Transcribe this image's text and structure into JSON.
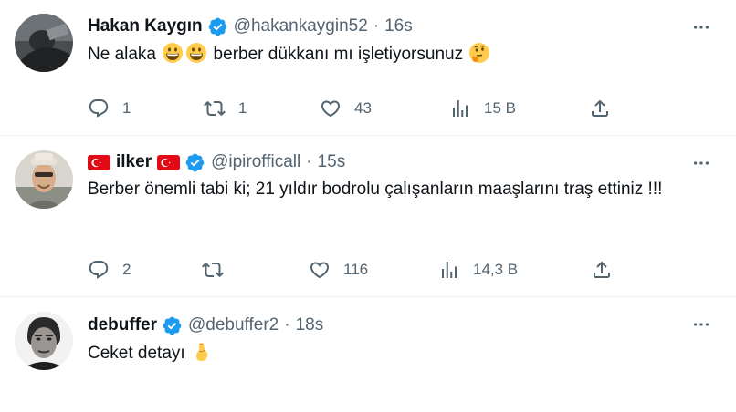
{
  "tweets": [
    {
      "name": "Hakan Kaygın",
      "handle": "@hakankaygin52",
      "separator": "·",
      "time": "16s",
      "text_before": "Ne alaka ",
      "text_after": " berber dükkanı mı işletiyorsunuz ",
      "emojis": [
        "grinning-face-emoji",
        "grinning-face-emoji",
        "thinking-face-emoji"
      ],
      "replies": "1",
      "reposts": "1",
      "likes": "43",
      "views": "15 B"
    },
    {
      "name": "ilker",
      "handle": "@ipirofficall",
      "separator": "·",
      "time": "15s",
      "text": "Berber önemli tabi ki;  21 yıldır bodrolu çalışanların maaşlarını traş ettiniz !!!",
      "replies": "2",
      "reposts": "",
      "likes": "116",
      "views": "14,3 B"
    },
    {
      "name": "debuffer",
      "handle": "@debuffer2",
      "separator": "·",
      "time": "18s",
      "text": "Ceket detayı ",
      "emojis": [
        "pinched-fingers-emoji"
      ]
    }
  ],
  "icons": [
    "verified-badge-icon",
    "more-icon",
    "reply-icon",
    "repost-icon",
    "like-icon",
    "views-icon",
    "share-icon",
    "turkish-flag-icon"
  ],
  "colors": {
    "verified": "#1d9bf0",
    "secondary_text": "#536471",
    "primary_text": "#0f1419",
    "divider": "#eff3f4",
    "flag_red": "#e30a17"
  }
}
